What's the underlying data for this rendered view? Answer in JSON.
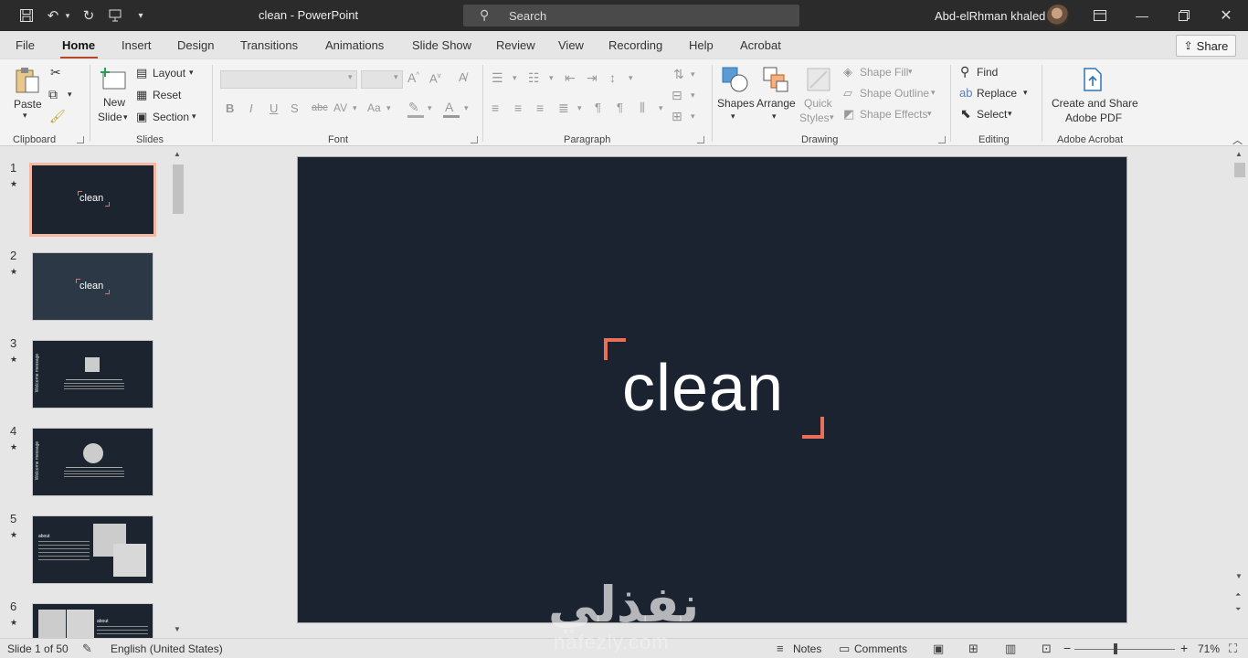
{
  "window": {
    "doc_title": "clean  -  PowerPoint",
    "search_placeholder": "Search",
    "user_name": "Abd-elRhman khaled"
  },
  "menu": {
    "tabs": [
      "File",
      "Home",
      "Insert",
      "Design",
      "Transitions",
      "Animations",
      "Slide Show",
      "Review",
      "View",
      "Recording",
      "Help",
      "Acrobat"
    ],
    "active_tab": "Home",
    "share_label": "Share"
  },
  "ribbon": {
    "clipboard": {
      "paste": "Paste",
      "label": "Clipboard"
    },
    "slides": {
      "new_slide_1": "New",
      "new_slide_2": "Slide",
      "layout": "Layout",
      "reset": "Reset",
      "section": "Section",
      "label": "Slides"
    },
    "font": {
      "label": "Font",
      "bold": "B",
      "italic": "I",
      "underline": "U",
      "shadow": "S",
      "strike": "abc",
      "spacing": "AV",
      "case": "Aa"
    },
    "paragraph": {
      "label": "Paragraph"
    },
    "drawing": {
      "shapes": "Shapes",
      "arrange": "Arrange",
      "quick_1": "Quick",
      "quick_2": "Styles",
      "shape_fill": "Shape Fill",
      "shape_outline": "Shape Outline",
      "shape_effects": "Shape Effects",
      "label": "Drawing"
    },
    "editing": {
      "find": "Find",
      "replace": "Replace",
      "select": "Select",
      "label": "Editing"
    },
    "acrobat": {
      "create_1": "Create and Share",
      "create_2": "Adobe PDF",
      "label": "Adobe Acrobat"
    }
  },
  "thumbnails": [
    {
      "num": "1",
      "text": "clean"
    },
    {
      "num": "2",
      "text": "clean"
    },
    {
      "num": "3",
      "side": "Welcome message"
    },
    {
      "num": "4",
      "side": "Welcome message"
    },
    {
      "num": "5",
      "head": "about"
    },
    {
      "num": "6",
      "head": "about"
    }
  ],
  "slide": {
    "title": "clean"
  },
  "watermark": {
    "arabic": "نفذلي",
    "latin": "nafezly.com"
  },
  "status": {
    "slide_info": "Slide 1 of 50",
    "language": "English (United States)",
    "notes": "Notes",
    "comments": "Comments",
    "zoom": "71%"
  },
  "colors": {
    "accent": "#b7472a",
    "slide_bg": "#1b2331",
    "bracket": "#e8705a",
    "selection": "#f4b8a4"
  }
}
